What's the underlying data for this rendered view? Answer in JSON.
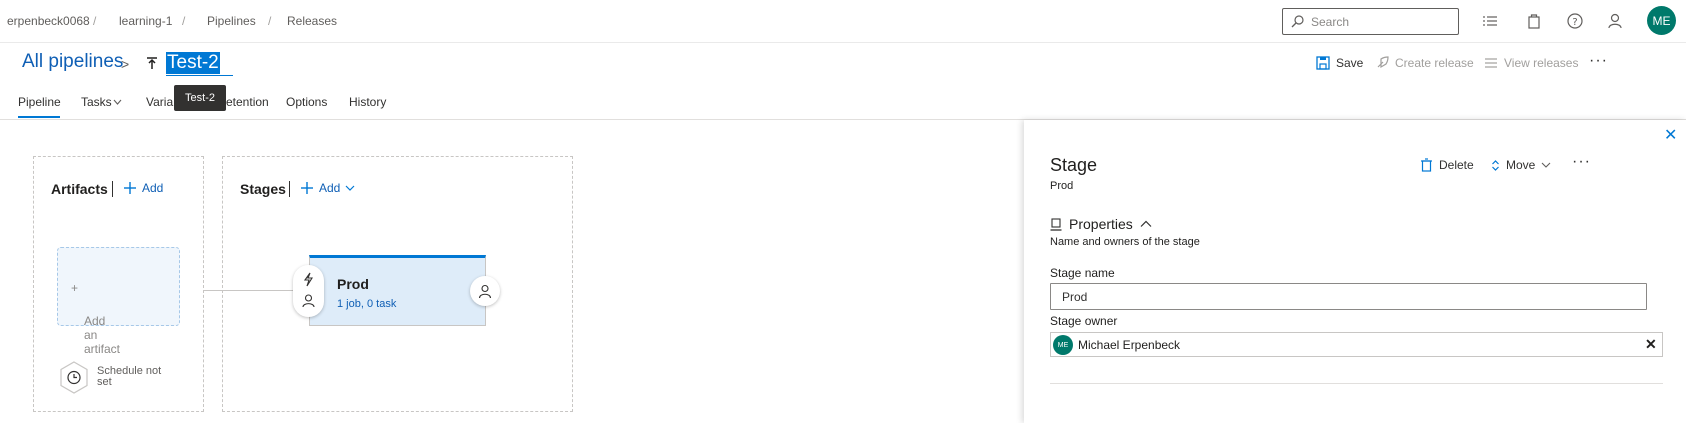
{
  "breadcrumb": [
    "erpenbeck0068",
    "learning-1",
    "Pipelines",
    "Releases"
  ],
  "search": {
    "placeholder": "Search"
  },
  "user": {
    "initials": "ME"
  },
  "title": {
    "all_pipelines": "All pipelines",
    "pipeline_name": "Test-2",
    "tooltip": "Test-2"
  },
  "actions": {
    "save": "Save",
    "create_release": "Create release",
    "view_releases": "View releases",
    "more": "···"
  },
  "tabs": [
    {
      "label": "Pipeline",
      "active": true
    },
    {
      "label": "Tasks"
    },
    {
      "label": "Varia"
    },
    {
      "label": "etention"
    },
    {
      "label": "Options"
    },
    {
      "label": "History"
    }
  ],
  "canvas": {
    "artifacts_title": "Artifacts",
    "artifacts_add": "Add",
    "add_artifact": "Add an artifact",
    "schedule_line1": "Schedule not",
    "schedule_line2": "set",
    "stages_title": "Stages",
    "stages_add": "Add",
    "stage": {
      "name": "Prod",
      "summary": "1 job, 0 task"
    }
  },
  "panel": {
    "title": "Stage",
    "subtitle": "Prod",
    "delete": "Delete",
    "move": "Move",
    "more": "···",
    "properties": "Properties",
    "properties_desc": "Name and owners of the stage",
    "stage_name_label": "Stage name",
    "stage_name_value": "Prod",
    "stage_owner_label": "Stage owner",
    "owner_initials": "ME",
    "owner_name": "Michael Erpenbeck",
    "remove": "✕"
  },
  "colors": {
    "accent": "#0078d4",
    "avatar": "#00796b",
    "link": "#0f5fb5"
  }
}
